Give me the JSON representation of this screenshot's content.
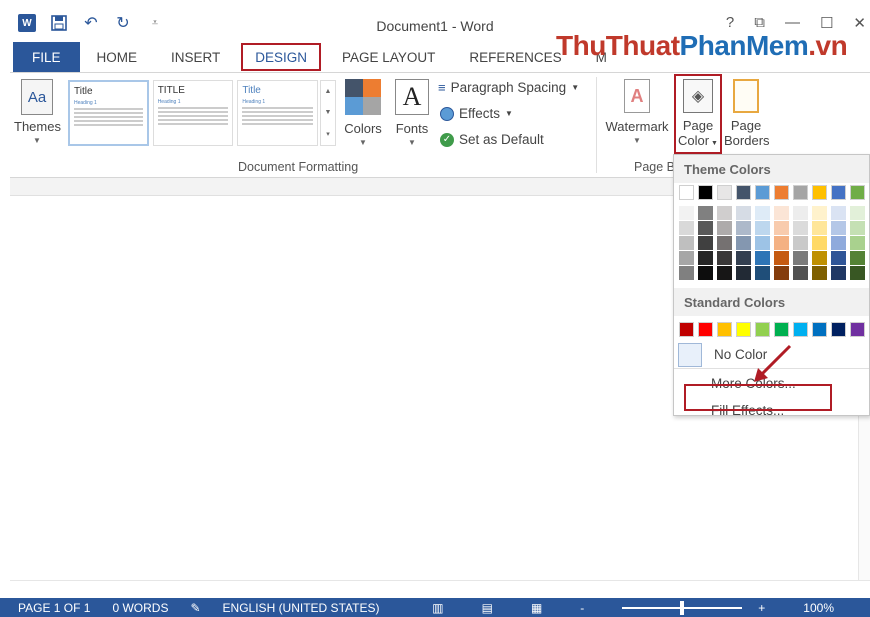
{
  "titlebar": {
    "title": "Document1 - Word",
    "undo_icon": "undo-icon",
    "redo_icon": "redo-icon",
    "help": "?",
    "ctrl_restore": "⧉",
    "ctrl_min": "—",
    "ctrl_max": "☐",
    "ctrl_close": "✕"
  },
  "tabs": [
    "FILE",
    "HOME",
    "INSERT",
    "DESIGN",
    "PAGE LAYOUT",
    "REFERENCES",
    "M"
  ],
  "watermark": {
    "part1": "ThuThuat",
    "part2": "PhanMem",
    "part3": ".vn"
  },
  "ribbon": {
    "themes": "Themes",
    "themes_icon_text": "Aa",
    "gallery": [
      {
        "title": "Title",
        "heading": "Heading 1"
      },
      {
        "title": "TITLE",
        "heading": "Heading 1"
      },
      {
        "title": "Title",
        "heading": "Heading 1"
      }
    ],
    "colors": "Colors",
    "fonts": "Fonts",
    "fonts_icon_text": "A",
    "paragraph_spacing": "Paragraph Spacing",
    "effects": "Effects",
    "set_default": "Set as Default",
    "group_label": "Document Formatting",
    "watermark": "Watermark",
    "page_color_1": "Page",
    "page_color_2": "Color",
    "page_borders_1": "Page",
    "page_borders_2": "Borders",
    "page_bg_label": "Page B"
  },
  "dropdown": {
    "theme_header": "Theme Colors",
    "standard_header": "Standard Colors",
    "no_color": "No Color",
    "more_colors": "More Colors...",
    "fill_effects": "Fill Effects..."
  },
  "theme_colors": [
    "#ffffff",
    "#000000",
    "#e7e6e6",
    "#44546a",
    "#5b9bd5",
    "#ed7d31",
    "#a5a5a5",
    "#ffc000",
    "#4472c4",
    "#70ad47"
  ],
  "theme_shades": [
    [
      "#f2f2f2",
      "#d9d9d9",
      "#bfbfbf",
      "#a6a6a6",
      "#808080"
    ],
    [
      "#808080",
      "#595959",
      "#404040",
      "#262626",
      "#0d0d0d"
    ],
    [
      "#d0cece",
      "#aeabab",
      "#757171",
      "#3a3838",
      "#171616"
    ],
    [
      "#d6dce5",
      "#adb9ca",
      "#8497b0",
      "#333f50",
      "#222a35"
    ],
    [
      "#deebf7",
      "#bdd7ee",
      "#9dc3e6",
      "#2e75b6",
      "#1f4e79"
    ],
    [
      "#fbe5d6",
      "#f8cbad",
      "#f4b183",
      "#c55a11",
      "#843c0c"
    ],
    [
      "#ededed",
      "#dbdbdb",
      "#c9c9c9",
      "#7b7b7b",
      "#525252"
    ],
    [
      "#fff2cc",
      "#ffe699",
      "#ffd966",
      "#bf9000",
      "#7f6000"
    ],
    [
      "#dae3f3",
      "#b4c7e7",
      "#8faadc",
      "#2f5597",
      "#203864"
    ],
    [
      "#e2f0d9",
      "#c5e0b4",
      "#a9d18e",
      "#548235",
      "#385723"
    ]
  ],
  "standard_colors": [
    "#c00000",
    "#ff0000",
    "#ffc000",
    "#ffff00",
    "#92d050",
    "#00b050",
    "#00b0f0",
    "#0070c0",
    "#002060",
    "#7030a0"
  ],
  "status": {
    "page": "PAGE 1 OF 1",
    "words": "0 WORDS",
    "language": "ENGLISH (UNITED STATES)",
    "zoom_minus": "-",
    "zoom_plus": "+",
    "zoom": "100%"
  },
  "zoom_level_percent": 100
}
